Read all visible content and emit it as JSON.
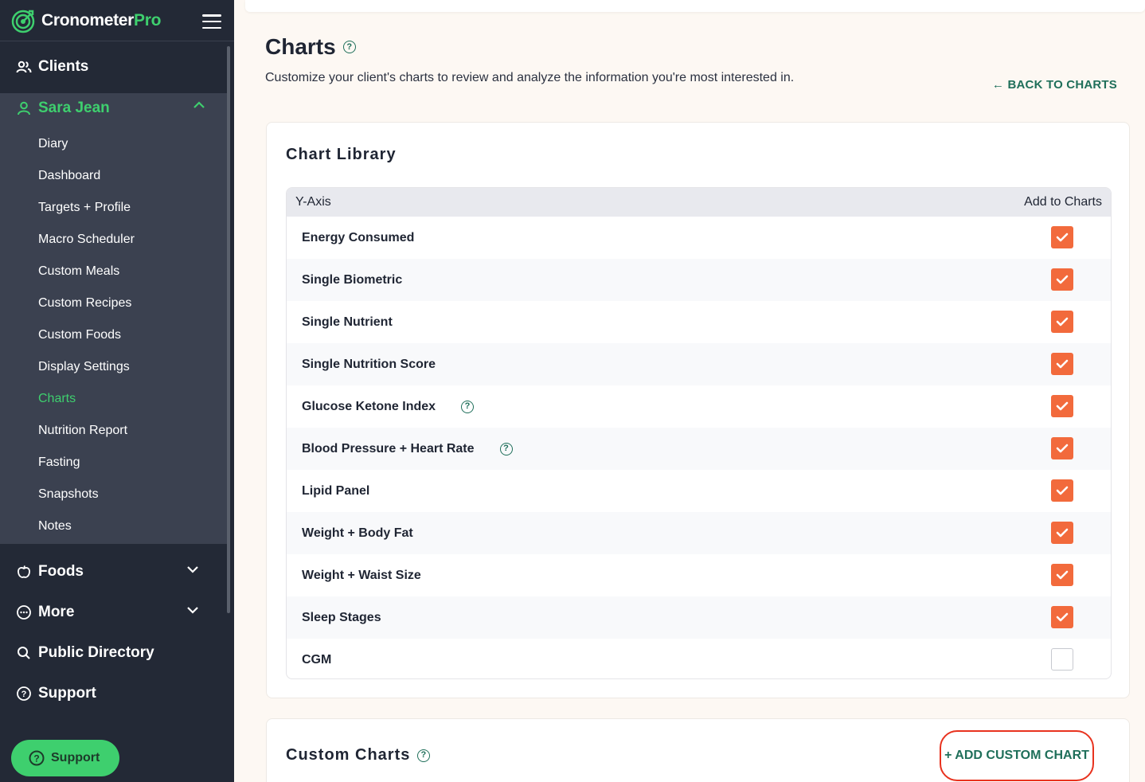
{
  "app": {
    "name": "Cronometer",
    "suffix": "Pro"
  },
  "nav": {
    "clients": "Clients",
    "client": {
      "name": "Sara Jean",
      "items": [
        {
          "label": "Diary",
          "active": false
        },
        {
          "label": "Dashboard",
          "active": false
        },
        {
          "label": "Targets + Profile",
          "active": false
        },
        {
          "label": "Macro Scheduler",
          "active": false
        },
        {
          "label": "Custom Meals",
          "active": false
        },
        {
          "label": "Custom Recipes",
          "active": false
        },
        {
          "label": "Custom Foods",
          "active": false
        },
        {
          "label": "Display Settings",
          "active": false
        },
        {
          "label": "Charts",
          "active": true
        },
        {
          "label": "Nutrition Report",
          "active": false
        },
        {
          "label": "Fasting",
          "active": false
        },
        {
          "label": "Snapshots",
          "active": false
        },
        {
          "label": "Notes",
          "active": false
        }
      ]
    },
    "foods": "Foods",
    "more": "More",
    "public_directory": "Public Directory",
    "support": "Support",
    "support_button": "Support"
  },
  "page": {
    "title": "Charts",
    "subtitle": "Customize your client's charts to review and analyze the information you're most interested in.",
    "back_link": "← BACK TO CHARTS"
  },
  "library": {
    "title": "Chart Library",
    "col_y_axis": "Y-Axis",
    "col_add": "Add to Charts",
    "rows": [
      {
        "label": "Energy Consumed",
        "checked": true,
        "help": false
      },
      {
        "label": "Single Biometric",
        "checked": true,
        "help": false
      },
      {
        "label": "Single Nutrient",
        "checked": true,
        "help": false
      },
      {
        "label": "Single Nutrition Score",
        "checked": true,
        "help": false
      },
      {
        "label": "Glucose Ketone Index",
        "checked": true,
        "help": true
      },
      {
        "label": "Blood Pressure + Heart Rate",
        "checked": true,
        "help": true
      },
      {
        "label": "Lipid Panel",
        "checked": true,
        "help": false
      },
      {
        "label": "Weight + Body Fat",
        "checked": true,
        "help": false
      },
      {
        "label": "Weight + Waist Size",
        "checked": true,
        "help": false
      },
      {
        "label": "Sleep Stages",
        "checked": true,
        "help": false
      },
      {
        "label": "CGM",
        "checked": false,
        "help": false
      }
    ]
  },
  "custom": {
    "title": "Custom Charts",
    "add_button": "+ ADD CUSTOM CHART"
  },
  "colors": {
    "sidebar_bg": "#232936",
    "sidebar_active_bg": "#3b4150",
    "accent_green": "#3ecf6e",
    "link_teal": "#1f6f5a",
    "checkbox_orange": "#f26a3c",
    "highlight_red": "#e8321e"
  }
}
